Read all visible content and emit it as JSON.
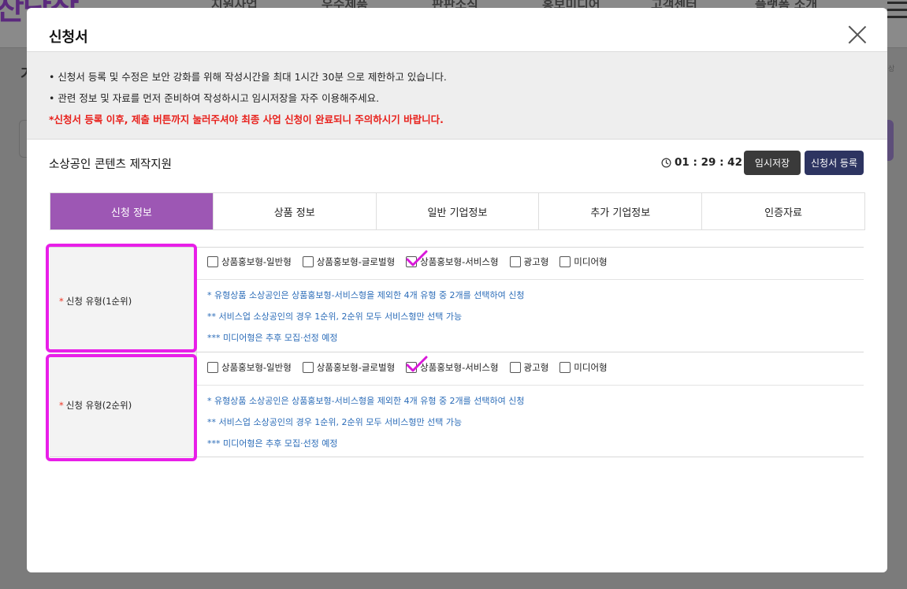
{
  "background": {
    "logo": "찬단상",
    "nav": [
      "지원사업",
      "우수제품",
      "판판소식",
      "홍보미디어",
      "고객센터",
      "플랫폼 소개"
    ],
    "left_fragment": "기",
    "right_fragment": "상"
  },
  "modal": {
    "title": "신청서",
    "close_icon": "close-icon",
    "notices": [
      "• 신청서 등록 및 수정은 보안 강화를 위해 작성시간을 최대 1시간 30분 으로 제한하고 있습니다.",
      "• 관련 정보 및 자료를 먼저 준비하여 작성하시고 임시저장을 자주 이용해주세요.",
      "*신청서 등록 이후, 제출 버튼까지 눌러주셔야 최종 사업 신청이 완료되니 주의하시기 바랍니다."
    ],
    "program_title": "소상공인 콘텐츠 제작지원",
    "timer": "01 : 29 : 42",
    "buttons": {
      "save": "임시저장",
      "register": "신청서 등록"
    },
    "tabs": [
      "신청 정보",
      "상품 정보",
      "일반 기업정보",
      "추가 기업정보",
      "인증자료"
    ],
    "active_tab": 0,
    "rows": [
      {
        "label": "신청 유형(1순위)",
        "required": "*",
        "options": [
          {
            "label": "상품홍보형-일반형",
            "checked": false
          },
          {
            "label": "상품홍보형-글로벌형",
            "checked": false
          },
          {
            "label": "상품홍보형-서비스형",
            "checked": true
          },
          {
            "label": "광고형",
            "checked": false
          },
          {
            "label": "미디어형",
            "checked": false
          }
        ],
        "info": [
          "* 유형상품 소상공인은 상품홍보형-서비스형을 제외한 4개 유형 중 2개를 선택하여 신청",
          "** 서비스업 소상공인의 경우 1순위, 2순위 모두 서비스형만 선택 가능",
          "*** 미디어형은 추후 모집·선정 예정"
        ]
      },
      {
        "label": "신청 유형(2순위)",
        "required": "*",
        "options": [
          {
            "label": "상품홍보형-일반형",
            "checked": false
          },
          {
            "label": "상품홍보형-글로벌형",
            "checked": false
          },
          {
            "label": "상품홍보형-서비스형",
            "checked": true
          },
          {
            "label": "광고형",
            "checked": false
          },
          {
            "label": "미디어형",
            "checked": false
          }
        ],
        "info": [
          "* 유형상품 소상공인은 상품홍보형-서비스형을 제외한 4개 유형 중 2개를 선택하여 신청",
          "** 서비스업 소상공인의 경우 1순위, 2순위 모두 서비스형만 선택 가능",
          "*** 미디어형은 추후 모집·선정 예정"
        ]
      }
    ]
  },
  "colors": {
    "active_tab": "#9d57b4",
    "highlight": "#e81ee8",
    "info_text": "#2b6cb8",
    "warning_text": "#e8211c",
    "register_button": "#2d3461",
    "save_button": "#3a3a3a"
  }
}
